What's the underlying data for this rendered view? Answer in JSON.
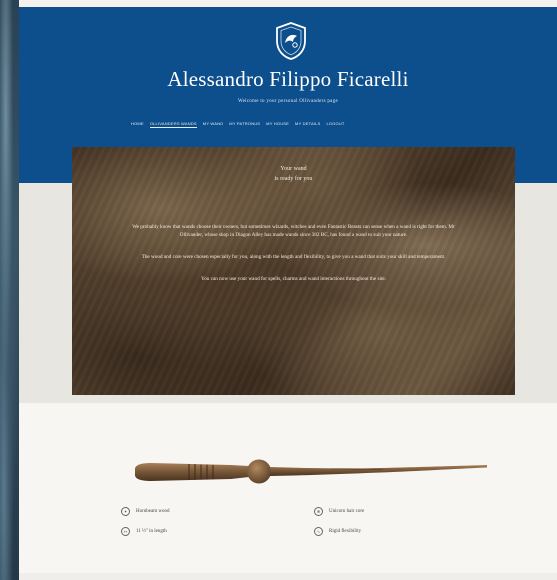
{
  "site": {
    "title": "Alessandro Filippo Ficarelli",
    "tagline": "Welcome to your personal Ollivanders page",
    "crest_icon": "shield-crest-icon"
  },
  "nav": {
    "items": [
      {
        "label": "Home"
      },
      {
        "label": "Ollivanders Wands"
      },
      {
        "label": "My Wand"
      },
      {
        "label": "My Patronus"
      },
      {
        "label": "My House"
      },
      {
        "label": "My Details"
      },
      {
        "label": "Logout"
      }
    ]
  },
  "hero": {
    "heading": "Your wand",
    "subheading": "is ready for you",
    "paragraphs": [
      "We probably know that wands choose their owners, but sometimes wizards, witches and even Fantastic Beasts can sense when a wand is right for them. Mr Ollivander, whose shop in Diagon Alley has made wands since 382 BC, has found a wand to suit your nature.",
      "The wood and core were chosen especially for you, along with the length and flexibility, to give you a wand that suits your skill and temperament.",
      "You can now use your wand for spells, charms and wand interactions throughout the site."
    ]
  },
  "wand": {
    "features": [
      {
        "icon": "wood-icon",
        "label": "Hornbeam wood"
      },
      {
        "icon": "core-icon",
        "label": "Unicorn hair core"
      },
      {
        "icon": "length-icon",
        "label": "11 ½\" in length"
      },
      {
        "icon": "flexibility-icon",
        "label": "Rigid flexibility"
      }
    ]
  },
  "colors": {
    "header_blue": "#0d4f8d",
    "page_bg": "#f7f6f3",
    "wand_brown": "#7a5a3a"
  }
}
